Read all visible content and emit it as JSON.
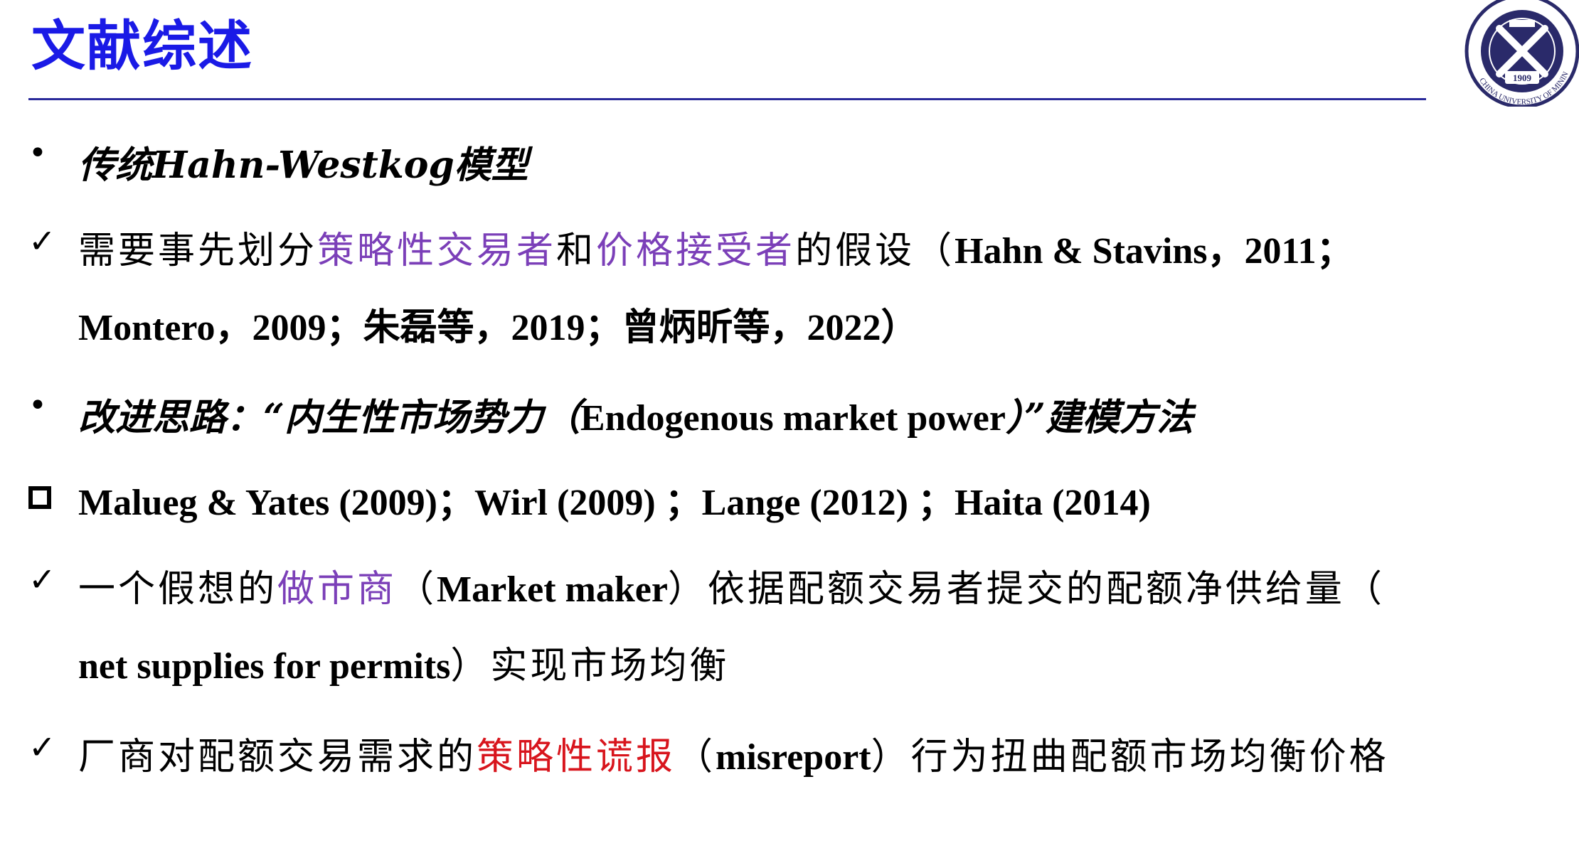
{
  "header": {
    "title": "文献综述",
    "logo_year": "1909",
    "logo_text": "CHINA UNIVERSITY OF MINING & TECH"
  },
  "lines": {
    "l1": "传统Hahn-Westkog模型",
    "l2_a": "需要事先划分",
    "l2_b": "策略性交易者",
    "l2_c": "和",
    "l2_d": "价格接受者",
    "l2_e": "的假设（",
    "l2_f": "Hahn & Stavins，2011；",
    "l3": "Montero，2009；朱磊等，2019；曾炳昕等，2022）",
    "l4_a": "改进思路：“内生性市场势力（",
    "l4_b": "Endogenous market power",
    "l4_c": "）”建模方法",
    "l5": "Malueg & Yates (2009)；Wirl (2009) ；Lange (2012) ；Haita (2014)",
    "l6_a": "一个假想的",
    "l6_b": "做市商",
    "l6_c": "（",
    "l6_d": "Market maker",
    "l6_e": "）依据配额交易者提交的配额净供给量（",
    "l7_a": "net supplies for permits",
    "l7_b": "）实现市场均衡",
    "l8_a": "厂商对配额交易需求的",
    "l8_b": "策略性谎报",
    "l8_c": "（",
    "l8_d": "misreport",
    "l8_e": "）行为扭曲配额市场均衡价格"
  },
  "colors": {
    "title": "#1a1ae6",
    "highlight_purple": "#7b3fb8",
    "highlight_red": "#d8151d",
    "rule": "#2a2a9a"
  }
}
